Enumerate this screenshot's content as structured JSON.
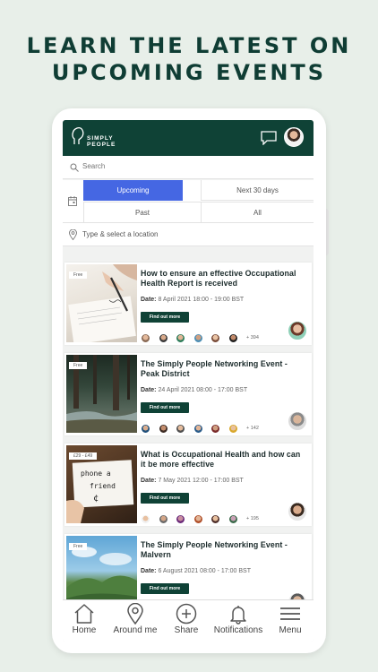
{
  "promo": {
    "line1": "LEARN THE LATEST ON",
    "line2": "UPCOMING EVENTS"
  },
  "brand": {
    "name_line1": "SIMPLY",
    "name_line2": "PEOPLE",
    "primary_color": "#0f4236",
    "accent_color": "#4567e3"
  },
  "search": {
    "placeholder": "Search"
  },
  "filters": {
    "upcoming": "Upcoming",
    "next30": "Next 30 days",
    "past": "Past",
    "all": "All"
  },
  "location": {
    "placeholder": "Type & select a location"
  },
  "events": [
    {
      "badge": "Free",
      "title": "How to ensure an effective Occupational Health Report is received",
      "date_label": "Date:",
      "date": "8 April 2021 18:00 - 19:00 BST",
      "button": "Find out more",
      "more_count": "+ 394"
    },
    {
      "badge": "Free",
      "title": "The Simply People Networking Event - Peak District",
      "date_label": "Date:",
      "date": "24 April 2021 08:00 - 17:00 BST",
      "button": "Find out more",
      "more_count": "+ 142"
    },
    {
      "badge": "£29 - £49",
      "title": "What is Occupational Health and how can it be more effective",
      "date_label": "Date:",
      "date": "7 May 2021 12:00 - 17:00 BST",
      "button": "Find out more",
      "more_count": "+ 195",
      "image_text": "phone a friend"
    },
    {
      "badge": "Free",
      "title": "The Simply People Networking Event - Malvern",
      "date_label": "Date:",
      "date": "6 August 2021 08:00 - 17:00 BST",
      "button": "Find out more",
      "more_count": ""
    }
  ],
  "nav": {
    "home": "Home",
    "around": "Around me",
    "share": "Share",
    "notifications": "Notifications",
    "menu": "Menu"
  }
}
